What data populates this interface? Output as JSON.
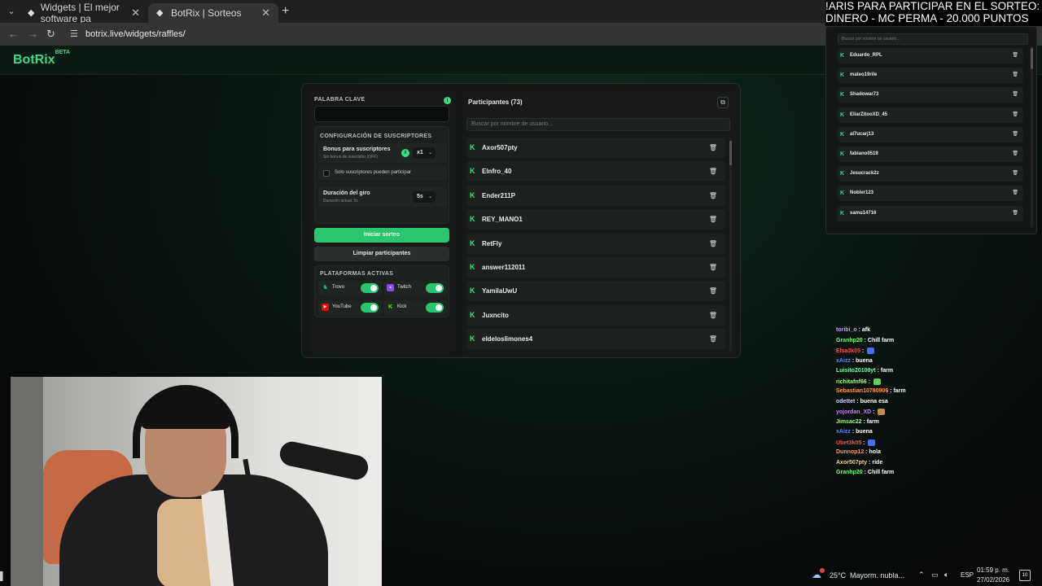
{
  "browser": {
    "tabs": [
      {
        "title": "Widgets | El mejor software pa",
        "active": false
      },
      {
        "title": "BotRix | Sorteos",
        "active": true
      }
    ],
    "url": "botrix.live/widgets/raffles/"
  },
  "brand": {
    "name": "BotRix",
    "badge": "BETA",
    "accent": "#3ddc84"
  },
  "left_panel": {
    "keyword_label": "PALABRA CLAVE",
    "keyword_value": "",
    "subs_config_title": "CONFIGURACIÓN DE SUSCRIPTORES",
    "bonus_title": "Bonus para suscriptores",
    "bonus_sub": "Sin bonus de suscriptor (OFF)",
    "bonus_value": "x1",
    "only_subs_label": "Solo suscriptores pueden participar",
    "only_subs_checked": false,
    "duration_title": "Duración del giro",
    "duration_sub": "Duración actual: 5s",
    "duration_value": "5s",
    "start_button": "Iniciar sorteo",
    "clear_button": "Limpiar participantes",
    "platforms_title": "PLATAFORMAS ACTIVAS",
    "platforms": [
      {
        "name": "Trovo",
        "enabled": true,
        "color": "#19c37d"
      },
      {
        "name": "Twitch",
        "enabled": true,
        "color": "#9146ff"
      },
      {
        "name": "YouTube",
        "enabled": true,
        "color": "#ff0000"
      },
      {
        "name": "Kick",
        "enabled": true,
        "color": "#53fc18"
      }
    ]
  },
  "participants": {
    "title": "Participantes (73)",
    "search_placeholder": "Buscar por nombre de usuario...",
    "list": [
      "Axor507pty",
      "Elnfro_40",
      "Ender211P",
      "REY_MANO1",
      "RetFly",
      "answer112011",
      "YamilaUwU",
      "Juxncito",
      "eldeloslimones4"
    ]
  },
  "overlay": {
    "banner_line1": "!ARIS PARA PARTICIPAR EN EL SORTEO:",
    "banner_line2": "DINERO - MC PERMA - 20.000 PUNTOS",
    "search_placeholder": "Buscar por nombre de usuario...",
    "list": [
      "Eduardo_RPL",
      "mateo19rile",
      "Shadowar73",
      "EliarZitooXD_45",
      "al7ucarj13",
      "fabiano0519",
      "Jesucrack2z",
      "Nobler123",
      "samu14716"
    ]
  },
  "chat": [
    {
      "user": "toribi_o",
      "message": "afk",
      "color": "#c9a0ff"
    },
    {
      "user": "Granhp20",
      "message": "Chill farm",
      "color": "#6dff6d"
    },
    {
      "user": "Elsa3k05",
      "message": "",
      "color": "#ff4d4d",
      "emote": "#4a6cff"
    },
    {
      "user": "xAizz",
      "message": "buena",
      "color": "#5a8bff"
    },
    {
      "user": "Luisito20100yt",
      "message": "farm",
      "color": "#7dffb0"
    },
    {
      "user": "richitafnf66",
      "message": "",
      "color": "#9dff7d",
      "emote": "#5ad05a"
    },
    {
      "user": "Sebastian10780906",
      "message": "farm",
      "color": "#ff9c3d"
    },
    {
      "user": "odettet",
      "message": "buena esa",
      "color": "#d0d0ff"
    },
    {
      "user": "yojordan_XD",
      "message": "",
      "color": "#c67dff",
      "emote": "#c08a4a"
    },
    {
      "user": "Jimsac22",
      "message": "farm",
      "color": "#9dff7d"
    },
    {
      "user": "xAizz",
      "message": "buena",
      "color": "#5a8bff"
    },
    {
      "user": "Ubet3k05",
      "message": "",
      "color": "#ff4d4d",
      "emote": "#4a6cff"
    },
    {
      "user": "Dunnop12",
      "message": "hola",
      "color": "#ff9c3d"
    },
    {
      "user": "Axor507pty",
      "message": "ride",
      "color": "#ffd07d"
    },
    {
      "user": "Granhp20",
      "message": "Chill farm",
      "color": "#6dff6d"
    }
  ],
  "taskbar": {
    "temperature": "25°C",
    "weather": "Mayorm. nubla...",
    "language": "ESP",
    "time": "01:59 p. m.",
    "date": "27/02/2026",
    "notifications": "10"
  }
}
